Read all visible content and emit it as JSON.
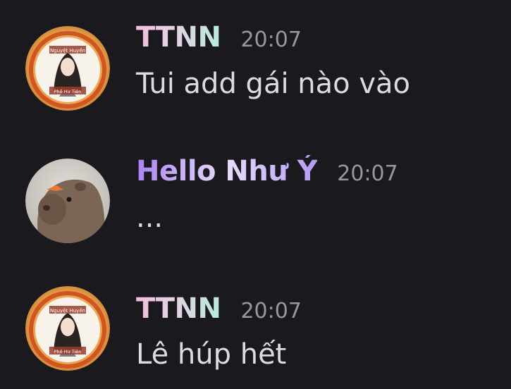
{
  "messages": [
    {
      "username": "TTNN",
      "timestamp": "20:07",
      "text": "Tui add gái nào vào",
      "avatar": {
        "top_text": "Nguyệt Huyền",
        "bottom_text": "Phố Hư Tiên"
      }
    },
    {
      "username": "Hello Như Ý",
      "timestamp": "20:07",
      "text": "...",
      "avatar": {
        "icon": "capybara-avatar"
      }
    },
    {
      "username": "TTNN",
      "timestamp": "20:07",
      "text": "Lê húp hết",
      "avatar": {
        "top_text": "Nguyệt Huyền",
        "bottom_text": "Phố Hư Tiên"
      }
    }
  ],
  "colors": {
    "background": "#1a1a1e",
    "timestamp": "#97979f",
    "message_text": "#dbdbe0",
    "ttnn_gradient": [
      "#f1bfdc",
      "#b8ecdc"
    ],
    "hello_gradient": [
      "#a884f3",
      "#e7dcfb"
    ]
  }
}
